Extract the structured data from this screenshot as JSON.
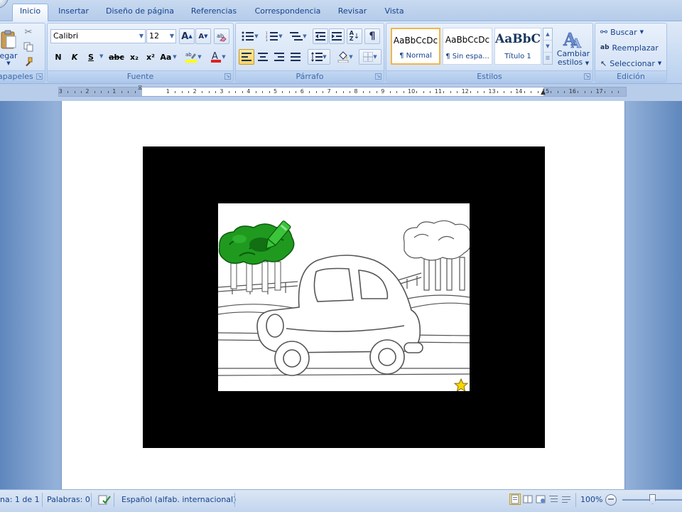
{
  "tabs": [
    {
      "label": "Inicio",
      "active": true
    },
    {
      "label": "Insertar"
    },
    {
      "label": "Diseño de página"
    },
    {
      "label": "Referencias"
    },
    {
      "label": "Correspondencia"
    },
    {
      "label": "Revisar"
    },
    {
      "label": "Vista"
    }
  ],
  "clipboard": {
    "paste_label": "egar",
    "group_label": "apapeles"
  },
  "font": {
    "family": "Calibri",
    "size": "12",
    "group_label": "Fuente",
    "bold": "N",
    "italic": "K",
    "underline": "S",
    "strike": "abc",
    "subscript": "x₂",
    "superscript": "x²",
    "case": "Aa",
    "grow": "A",
    "shrink": "A",
    "highlight_color": "#ffff00",
    "font_color": "#e02020"
  },
  "paragraph": {
    "group_label": "Párrafo",
    "pilcrow": "¶"
  },
  "styles": {
    "group_label": "Estilos",
    "items": [
      {
        "sample": "AaBbCcDc",
        "name": "¶ Normal",
        "selected": true
      },
      {
        "sample": "AaBbCcDc",
        "name": "¶ Sin espa..."
      },
      {
        "sample": "AaBbC",
        "name": "Título 1"
      }
    ],
    "change_line1": "Cambiar",
    "change_line2": "estilos"
  },
  "editing": {
    "group_label": "Edición",
    "find": "Buscar",
    "replace": "Reemplazar",
    "select": "Seleccionar"
  },
  "ruler": {
    "labels": [
      "3",
      "2",
      "1",
      "1",
      "2",
      "3",
      "4",
      "5",
      "6",
      "7",
      "8",
      "9",
      "10",
      "11",
      "12",
      "13",
      "14",
      "15",
      "16",
      "17"
    ]
  },
  "status": {
    "page": "na: 1 de 1",
    "words": "Palabras: 0",
    "language": "Español (alfab. internacional)",
    "zoom": "100%"
  },
  "colors": {
    "tree_green": "#1f9a1f",
    "crayon_green": "#39c43a",
    "star": "#f5d800"
  }
}
